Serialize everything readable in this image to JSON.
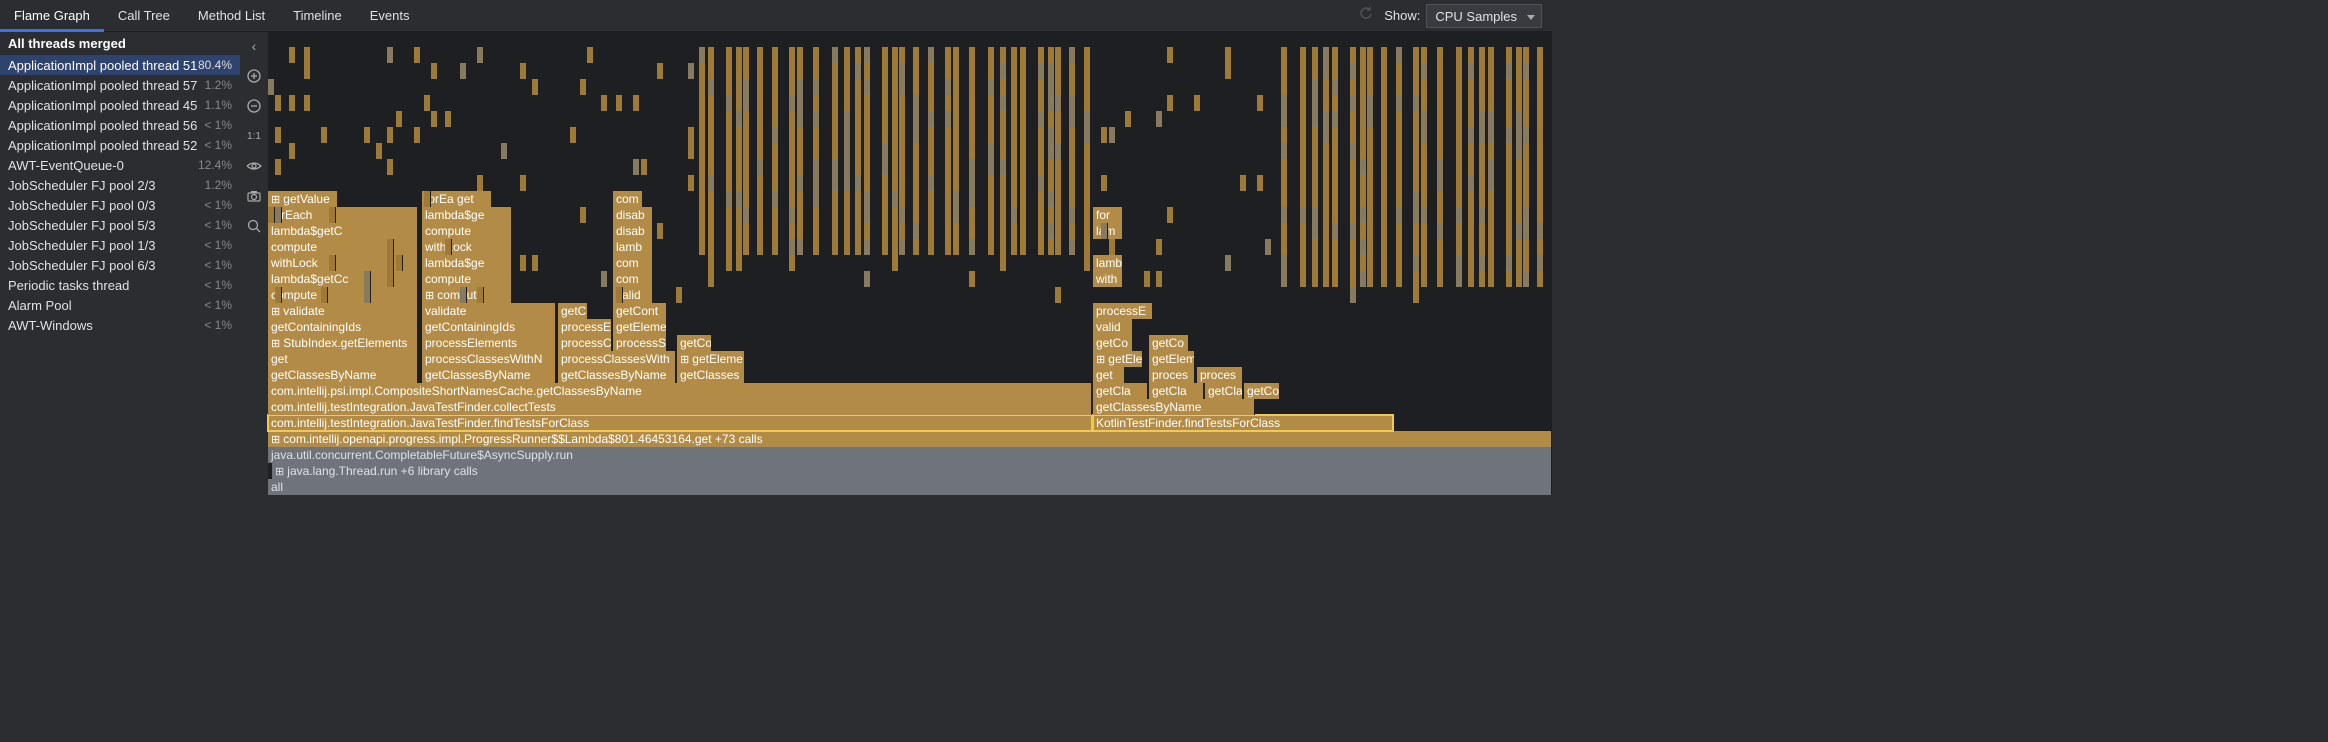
{
  "tabs": [
    "Flame Graph",
    "Call Tree",
    "Method List",
    "Timeline",
    "Events"
  ],
  "active_tab": 0,
  "show_label": "Show:",
  "show_value": "CPU Samples",
  "threads_header": "All threads merged",
  "threads": [
    {
      "name": "ApplicationImpl pooled thread 51",
      "pct": "80.4%",
      "selected": true
    },
    {
      "name": "ApplicationImpl pooled thread 57",
      "pct": "1.2%"
    },
    {
      "name": "ApplicationImpl pooled thread 45",
      "pct": "1.1%"
    },
    {
      "name": "ApplicationImpl pooled thread 56",
      "pct": "< 1%"
    },
    {
      "name": "ApplicationImpl pooled thread 52",
      "pct": "< 1%"
    },
    {
      "name": "AWT-EventQueue-0",
      "pct": "12.4%"
    },
    {
      "name": "JobScheduler FJ pool 2/3",
      "pct": "1.2%"
    },
    {
      "name": "JobScheduler FJ pool 0/3",
      "pct": "< 1%"
    },
    {
      "name": "JobScheduler FJ pool 5/3",
      "pct": "< 1%"
    },
    {
      "name": "JobScheduler FJ pool 1/3",
      "pct": "< 1%"
    },
    {
      "name": "JobScheduler FJ pool 6/3",
      "pct": "< 1%"
    },
    {
      "name": "Periodic tasks thread",
      "pct": "< 1%"
    },
    {
      "name": "Alarm Pool",
      "pct": "< 1%"
    },
    {
      "name": "AWT-Windows",
      "pct": "< 1%"
    }
  ],
  "tool_ratio": "1:1",
  "frames": {
    "all": "all",
    "thread_run": "java.lang.Thread.run  +6 library calls",
    "async_supply": "java.util.concurrent.CompletableFuture$AsyncSupply.run",
    "progress_runner": "com.intellij.openapi.progress.impl.ProgressRunner$$Lambda$801.46453164.get  +73 calls",
    "find_tests_java": "com.intellij.testIntegration.JavaTestFinder.findTestsForClass",
    "find_tests_kotlin": "KotlinTestFinder.findTestsForClass",
    "collect_tests": "com.intellij.testIntegration.JavaTestFinder.collectTests",
    "composite_cache": "com.intellij.psi.impl.CompositeShortNamesCache.getClassesByName",
    "get_classes_by_name": "getClassesByName",
    "get_classes": "getClasses",
    "getCla": "getCla",
    "getCo": "getCo",
    "get": "get",
    "stub_index": "StubIndex.getElements",
    "process_elements": "processElements",
    "process_classes_withn": "processClassesWithN",
    "process_classes_with": "processClassesWith",
    "processCo": "processC",
    "processEl": "processE",
    "processS": "processS",
    "getElemen": "getEleme",
    "getEleme": "getEleme",
    "validate": "validate",
    "valid": "valid",
    "getContainingIds": "getContainingIds",
    "getCl": "getC",
    "compute": "compute",
    "lambda_getC": "lambda$getC",
    "lambda_getCc": "lambda$getCc",
    "withLock": "withLock",
    "lambda_ge": "lambda$ge",
    "disabl": "disab",
    "lamb": "lamb",
    "forEach": "forEach",
    "forEa_get": "forEa  get",
    "getValue": "getValue",
    "com": "com",
    "for": "for",
    "lam": "lam",
    "with": "with",
    "proces": "proces",
    "process": "process",
    "getCont": "getCont",
    "getElemen2": "getElemen"
  }
}
